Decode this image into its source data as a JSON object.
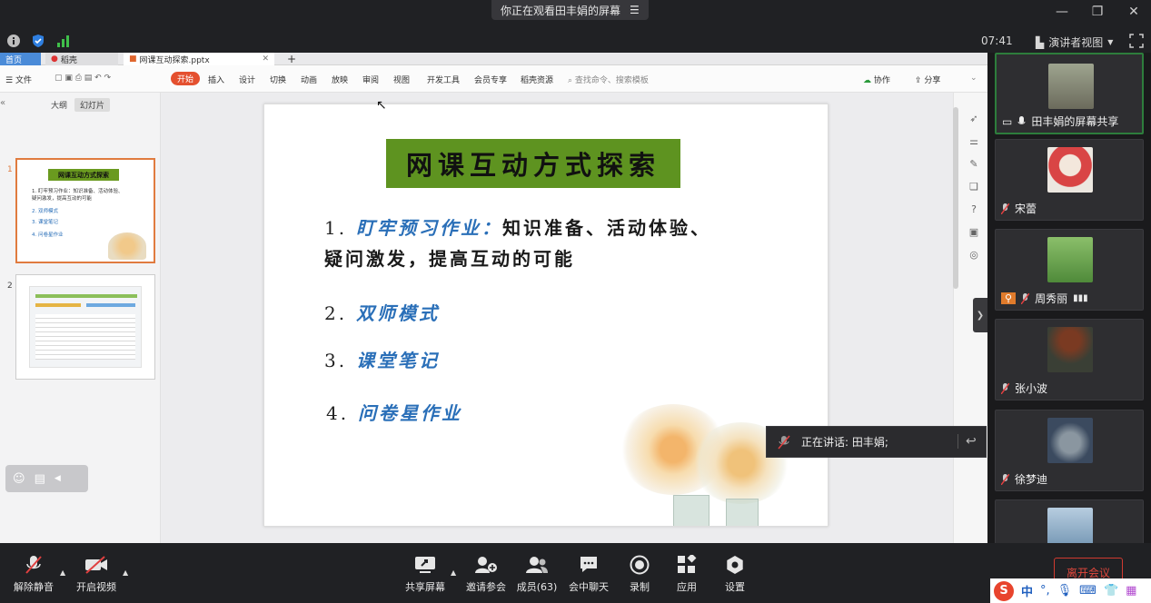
{
  "window": {
    "share_title": "你正在观看田丰娟的屏幕",
    "clock": "07:41",
    "presenter_view": "演讲者视图"
  },
  "wps": {
    "tabs": {
      "home": "首页",
      "doc": "稻壳",
      "file": "网课互动探索.pptx"
    },
    "file_menu": "文件",
    "menus": [
      "开始",
      "插入",
      "设计",
      "切换",
      "动画",
      "放映",
      "审阅",
      "视图",
      "开发工具",
      "会员专享",
      "稻壳资源"
    ],
    "search_placeholder": "查找命令、搜索模板",
    "collab": "协作",
    "share": "分享",
    "pane_tabs": [
      "大纲",
      "幻灯片"
    ],
    "slide_numbers": [
      "1",
      "2"
    ],
    "thumb1": {
      "title": "网课互动方式探索",
      "lines": [
        "1. 盯牢预习作业：知识准备、活动体验、",
        "疑问激发，提高互动的可能",
        "2. 双师模式",
        "3. 课堂笔记",
        "4. 问卷星作业"
      ]
    }
  },
  "slide": {
    "title": "网课互动方式探索",
    "item1_num": "1.",
    "item1_head": "盯牢预习作业：",
    "item1_rest": "知识准备、活动体验、",
    "item1_line2": "疑问激发，提高互动的可能",
    "item2_num": "2.",
    "item2": "双师模式",
    "item3_num": "3.",
    "item3": "课堂笔记",
    "item4_num": "4.",
    "item4": "问卷星作业"
  },
  "speaking": {
    "text": "正在讲话: 田丰娟;"
  },
  "participants": [
    {
      "name": "田丰娟的屏幕共享",
      "avatar_color": "#9a8f7a"
    },
    {
      "name": "宋蕾",
      "avatar_color": "#d94545"
    },
    {
      "name": "周秀丽",
      "avatar_color": "#4f8a3a"
    },
    {
      "name": "张小波",
      "avatar_color": "#3a3f35"
    },
    {
      "name": "徐梦迪",
      "avatar_color": "#3b4a5f"
    },
    {
      "name": "",
      "avatar_color": "#6b8fae"
    }
  ],
  "toolbar": {
    "mute": "解除静音",
    "video": "开启视频",
    "share": "共享屏幕",
    "invite": "邀请参会",
    "members": "成员(63)",
    "chat": "会中聊天",
    "record": "录制",
    "apps": "应用",
    "settings": "设置",
    "leave": "离开会议"
  },
  "ime": {
    "mode": "中"
  }
}
